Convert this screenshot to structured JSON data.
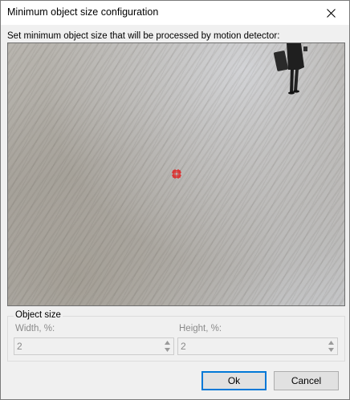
{
  "window": {
    "title": "Minimum object size configuration"
  },
  "instructions": "Set minimum object size that will be processed by motion detector:",
  "preview": {
    "marker_color": "#e02020"
  },
  "object_size": {
    "legend": "Object size",
    "width": {
      "label": "Width, %:",
      "value": "2"
    },
    "height": {
      "label": "Height, %:",
      "value": "2"
    }
  },
  "buttons": {
    "ok": "Ok",
    "cancel": "Cancel"
  },
  "colors": {
    "accent": "#0078d7",
    "disabled_text": "#8a8a8a"
  }
}
